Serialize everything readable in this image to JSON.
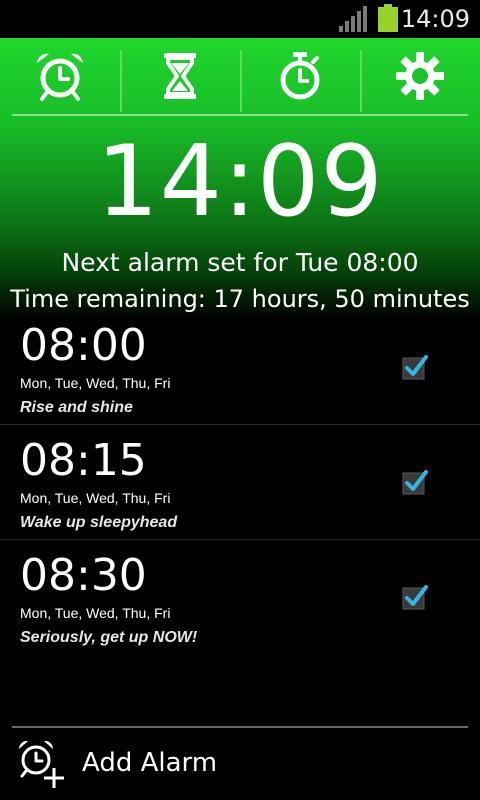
{
  "status_bar": {
    "time": "14:09",
    "battery_color": "#9bd22a",
    "icons": [
      "signal-icon",
      "battery-icon"
    ]
  },
  "tabs": [
    {
      "icon": "alarm-clock-icon"
    },
    {
      "icon": "hourglass-icon"
    },
    {
      "icon": "stopwatch-icon"
    },
    {
      "icon": "gear-icon"
    }
  ],
  "clock": {
    "time": "14:09",
    "next_alarm": "Next alarm set for Tue 08:00",
    "time_remaining": "Time remaining: 17 hours, 50 minutes"
  },
  "alarms": [
    {
      "time": "08:00",
      "days": "Mon, Tue, Wed, Thu, Fri",
      "label": "Rise and shine",
      "enabled": true
    },
    {
      "time": "08:15",
      "days": "Mon, Tue, Wed, Thu, Fri",
      "label": "Wake up sleepyhead",
      "enabled": true
    },
    {
      "time": "08:30",
      "days": "Mon, Tue, Wed, Thu, Fri",
      "label": "Seriously, get up NOW!",
      "enabled": true
    }
  ],
  "add_alarm": {
    "label": "Add Alarm",
    "icon": "add-alarm-icon"
  },
  "colors": {
    "accent_green": "#1fd72d",
    "check_blue": "#33b5e5"
  }
}
